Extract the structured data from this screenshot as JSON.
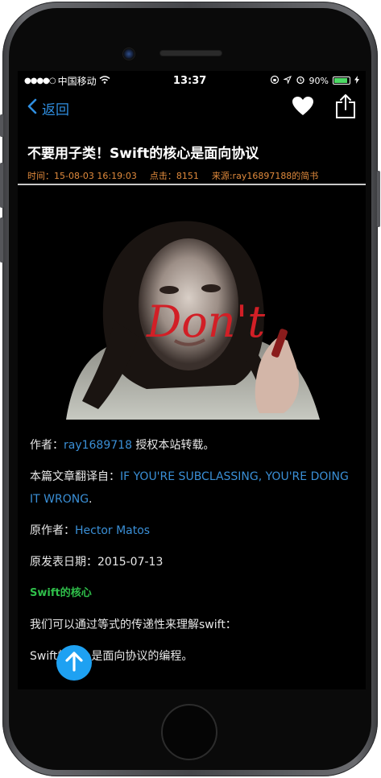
{
  "status": {
    "carrier": "中国移动",
    "signal_dots": "●●●●○",
    "time": "13:37",
    "battery_percent": "90%",
    "battery_level": 0.9
  },
  "nav": {
    "back_label": "返回",
    "back_icon": "chevron-left-icon",
    "favorite_icon": "heart-icon",
    "share_icon": "share-icon"
  },
  "article": {
    "title": "不要用子类！Swift的核心是面向协议",
    "meta_time": "时间：15-08-03 16:19:03",
    "meta_clicks": "点击：8151",
    "meta_source": "来源:ray16897188的简书",
    "hero_text": "Don't",
    "author_label": "作者：",
    "author_name": "ray1689718",
    "author_suffix": " 授权本站转载。",
    "translated_label": "本篇文章翻译自：",
    "translated_link": "IF YOU'RE SUBCLASSING, YOU'RE DOING IT WRONG",
    "translated_suffix": ".",
    "original_author_label": "原作者：",
    "original_author": "Hector Matos",
    "publish_date": "原发表日期：2015-07-13",
    "section_title": "Swift的核心",
    "paragraph_1": "我们可以通过等式的传递性来理解swift：",
    "paragraph_2": "Swift的核心是面向协议的编程。"
  },
  "colors": {
    "link": "#3a8fd6",
    "meta": "#e08a3c",
    "section": "#2fbf4a",
    "fab": "#1ea1f2",
    "nav_accent": "#2f8ee0"
  },
  "fab": {
    "icon": "arrow-up-icon"
  }
}
